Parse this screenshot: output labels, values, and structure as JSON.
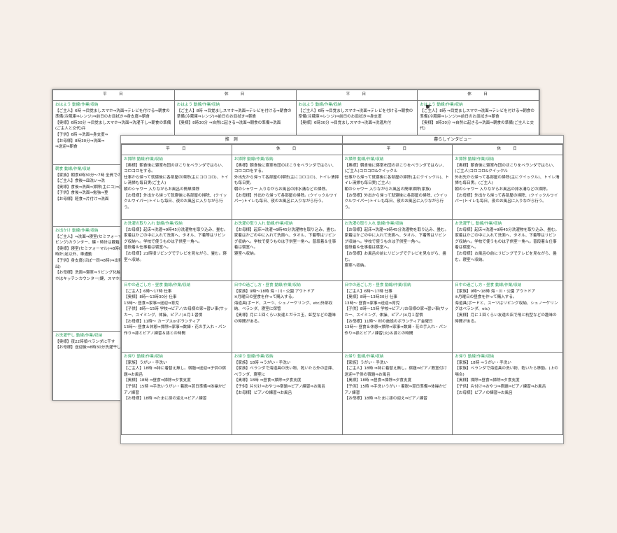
{
  "back": {
    "headers": [
      "平　　日",
      "休　　日",
      "平　　日",
      "休　　日"
    ],
    "rows": [
      [
        [
          "おはよう 動線/作業/収納",
          "【ご主人】6時 ⇒目覚ましスマホ⇒洗面⇒テレビを付ける⇒朝食の準備(冷蔵庫⇒レンジ)⇒前日のお皿拭き⇒身支度⇒朝食",
          "【奥様】6時30分 ⇒目覚ましスマホ⇒洗面⇒洗濯干し⇒朝食の準備(ご主人と交代)弁",
          "【子供】6時 ⇒洗面⇒身支度⇒",
          "【お母様】8時30分⇒洗面⇒",
          "⇒送迎⇒朝食"
        ],
        [
          "おはよう 動線/作業/収納",
          "【ご主人】8時 ⇒目覚ましスマホ⇒洗面⇒テレビを付ける⇒朝食の準備(冷蔵庫⇒レンジ)⇒前日のお皿拭き⇒朝食",
          "【奥様】8時30分 ⇒自然に起きる⇒洗面⇒朝食の準備⇒洗面"
        ],
        [
          "おはよう 動線/作業/収納",
          "【ご主人】6時 ⇒目覚ましスマホ⇒洗面⇒テレビを付ける⇒朝食の準備(冷蔵庫⇒レンジ)⇒前日のお皿拭き⇒身支度",
          "【奥様】6時30分 ⇒目覚ましスマホ⇒洗面⇒洗濯片付"
        ],
        [
          "おはよう 動線/作業/収納",
          "【ご主人】8時 ⇒目覚ましスマホ⇒洗面⇒テレビを付ける⇒朝食の準備(冷蔵庫⇒レンジ)⇒前日のお皿拭き⇒朝食",
          "【奥様】8時30分 ⇒自然に起きる⇒洗面⇒朝食の準備(ご主人と交代)"
        ]
      ],
      [
        [
          "朝食 動線/作業/収納",
          "【家族】朝食6時30分～7時 全員での食事、テレビは消す。",
          "【ご主人】食後⇒皿洗い⇒洗",
          "【奥様】食後⇒洗面⇒掃除(主にコ)⇒度⇒出勤",
          "【子供】食後⇒洗面⇒勉強⇒登",
          "【お母様】軽食⇒片付け⇒洗面"
        ]
      ],
      [
        [
          "お出かけ 動線/作業/収納",
          "【ご主人】⇒洗面⇒寝室(セミフォーマル)⇒7時10分出勤(カバンリビング)カウンター、鍵・時計は戴箱上に出勤",
          "【奥様】寝室(セミフォーマル)⇒8時00分出勤(カバン・スマホ・時計)足以外、車通勤",
          "【子供】身支度(ほぼ一同⇒8時)⇒出発(鍵を入れ、30分に追加⇒出)",
          "【お母様】洗面⇒寝室⇒リビング化粧⇒30分送迎(徒歩)⇒戻・スマホはキッチンカウンター(鍵、スマホ)出勤、車で"
        ]
      ],
      [
        [
          "お洗濯干し 動線/作業/収納",
          "【奥様】夜22時頃ベランダに干す",
          "【お母様】送迎後⇒8時30分洗濯干し"
        ]
      ]
    ]
  },
  "front": {
    "caption_left": "推　測",
    "caption_right": "暮らしインタビュー",
    "headers": [
      "平　　日",
      "休　　日",
      "平　　日",
      "休　　日"
    ],
    "rows": [
      [
        [
          "お掃除 動線/作業/収納",
          "【奥様】朝食後に寝室布団のほこりをベランダではらい、コロコロをする。",
          "仕事から帰って就寝後に各部屋の掃除(主にコロコロ)、トイレ清掃も毎日実(ご主人)",
          "朝のシャワー 入りながらお風呂の簡単掃除",
          "【お母様】外出から帰って就寝後に各部屋の掃除、(クイックルワイパー)トイレも毎日、夜のお風呂に入りながら行う。"
        ],
        [
          "お掃除 動線/作業/収納",
          "【奥様】朝食後に寝室布団のほこりをベランダではらい、コロコロをする。",
          "外出先から帰って各部屋の掃除(主にコロコロ)、トイレ清掃も毎日実。",
          "朝のシャワー 入りながらお風呂の排水溝などの掃除。",
          "【お母様】外出から帰って各部屋の掃除。(クイックルワイパー)トイレも毎日、夜のお風呂に入りながら行う。"
        ],
        [
          "お掃除 動線/作業/収納",
          "【奥様】朝食後に寝室布団のほこりをベランダではらい、(ご主人)コロコロ&クイックル",
          "仕事から帰って就寝後に各部屋の掃除(主にクイックル)、トイレ清掃も毎日実(ご主人)",
          "朝のシャワー 入りながらお風呂の簡単掃除(家族)",
          "【お母様】外出から帰って就寝後に各部屋の掃除、(クイックルワイパー)トイレも毎日、夜のお風呂に入りながら行う。"
        ],
        [
          "お掃除 動線/作業/収納",
          "【奥様】朝食後に寝室布団のほこりをベランダではらい、(ご主人)コロコロ&クイックル",
          "外出先から帰って各部屋の掃除(主にクイックル)、トイレ清掃も毎日実。(ご主人)",
          "朝のシャワー 入りながらお風呂の排水溝などの掃除。",
          "【お母様】外出から帰って各部屋の掃除、(クイックルワイパー)トイレも毎日、夜のお風呂に入りながら行う。"
        ]
      ],
      [
        [
          "お洗濯の取り入れ 動線/作業/収納",
          "【お母様】起床⇒洗濯⇒9時45分洗濯物を取り込み、畳む。家着はかごの中に入れて洗面へ、タオル、下着等はリビング収納へ。学校で使うものは子供室一角へ。",
          "普段着＆仕事着は寝室へ。",
          "【お母様】21時頃リビングでテレビを見ながら、畳む。寝室へ収納。"
        ],
        [
          "お洗濯の取り入れ 動線/作業/収納",
          "【お母様】起床⇒洗濯⇒9時45分洗濯物を取り込み、畳む。家着はかごの中に入れて洗面へ、タオル、下着等はリビング収納へ。学校で使うものは子供室一角へ。普段着＆仕事着は寝室へ。",
          "寝室へ収納。"
        ],
        [
          "お洗濯の取り入れ 動線/作業/収納",
          "【お母様】起床⇒洗濯⇒9時45分洗濯物を取り込み、畳む。家着はかごの中に入れて洗面へ、タオル、下着等はリビング収納へ。学校で使うものは子供室一角へ。",
          "普段着＆仕事着は寝室へ。",
          "【お母様】お風呂の前にリビングでテレビを見ながら、畳む。",
          "寝室へ収納。"
        ],
        [
          "お洗濯干し 動線/作業/収納",
          "【お母様】起床⇒洗濯⇒9時45分洗濯物を取り込み、畳む。家着はかごの中に入れて洗面へ、タオル、下着等はリビング収納へ。学校で使うものは子供室一角へ。普段着＆仕事着は寝室へ。",
          "【お母様】お風呂の前にリビングでテレビを見ながら、畳む。寝室へ収納。"
        ]
      ],
      [
        [
          "日中の過ごし方・昼食 動線/作業/収納",
          "【ご主人】6時～17時 仕事",
          "【奥様】8時～13時30分 仕事",
          "13時～ 昼食⇒家事⇒送迎⇒育児",
          "【子供】8時～15時 学校⇒ピアノ/お母様の家⇒習い事(サッカー、スイミング、体操、ピアノ)※月１習慣",
          "【お母様】11時～ カーブスorボランティア",
          "13時～ 昼食＆休憩⇒掃除⇒家事⇒数練・花の手入れ・パン作り⇒孫とピアノ練習＆孫との時間"
        ],
        [
          "日中の過ごし方・昼食 動線/作業/収納",
          "【家族】9時～18時 海・川・公園 アウトドア",
          "※月曜日の昼食を作って購入する。",
          "海道具(ボード、スーツ、シュノーケリング、etc)外部収納、ベランダ、寝室に保管",
          "【奥様】月に１回くらい友達とガラス玉、虹型などの趣味の時間がある。"
        ],
        [
          "日中の過ごし方・昼食 動線/作業/収納",
          "【ご主人】6時～17時 仕事",
          "【奥様】8時～13時30分 仕事",
          "13時～ 昼食⇒家事⇒送迎⇒育児",
          "【子供】8時～15時 学校⇒ピアノ/お母様の家⇒習い事(サッカー、スイミング、体操、ピアノ)※月１習慣",
          "【お母様】11時～ 村の施設のボランティア金曜日",
          "13時～ 昼食＆休憩⇒掃除⇒家事⇒数練・花の手入れ・パン作り⇒孫とピアノ練習(火)＆孫との時間"
        ],
        [
          "日中の過ごし方・昼食 動線/作業/収納",
          "【家族】9時～18時 海・川・公園 アウトドア",
          "※月曜日の昼食を作って購入する。",
          "海道具(ボードと、スーツはリビング収納、シュノーケリングはベランダ、etc)",
          "【奥様】月に１回くらい友達の店で飛と杭型などの趣味の時間がある。"
        ]
      ],
      [
        [
          "お帰り 動線/作業/収納",
          "【家族】うがい・手洗い",
          "【ご主人】18時 ⇒特に着替え無し。宿題⇒送迎⇒子供の宿題⇒お風呂",
          "【奥様】18時 ⇒昼食⇒掃除⇒夕食支度",
          "【子供】15時 ⇒手洗いうがい・着脱⇒翌日準備⇒体操かピアノ練習",
          "【お母様】18時 ⇒たまに孫の迎え⇒ピアノ練習"
        ],
        [
          "お帰り 動線/作業/収納",
          "【家族】18時 ⇒うがい・手洗い",
          "【家族】ベランダで海道具の洗い物、乾いたら外の倉庫、ベランダ、寝室に",
          "【奥様】18時 ⇒昼食⇒掃除⇒夕食支度",
          "【子供】片付け⇒おやつ⇒宿題⇒ピアノ練習⇒お風呂",
          "【お母様】ピアノの練習⇒お風呂"
        ],
        [
          "お帰り 動線/作業/収納",
          "【家族】うがい・手洗い",
          "【ご主人】18時 ⇒特に着替え無し。宿題⇒ピアノ教室付け送迎⇒子供の宿題⇒お風呂",
          "【奥様】18時 ⇒昼食⇒掃除⇒夕食支度",
          "【子供】15時 ⇒手洗いうがい・着脱⇒翌日準備⇒体操かピアノ練習",
          "【お母様】18時 ⇒たまに孫の迎え⇒ピアノ練習"
        ],
        [
          "お帰り 動線/作業/収納",
          "【家族】18時 ⇒うがい・手洗い",
          "【家族】ベランダで海道具の洗い物、乾いたら移動。(上の場合)",
          "【奥様】掃除⇒昼食⇒掃除⇒夕食支度",
          "【子供】片付け⇒おやつ⇒宿題⇒ピアノ練習⇒お風呂",
          "【お母様】ピアノの練習⇒お風呂"
        ]
      ]
    ]
  }
}
